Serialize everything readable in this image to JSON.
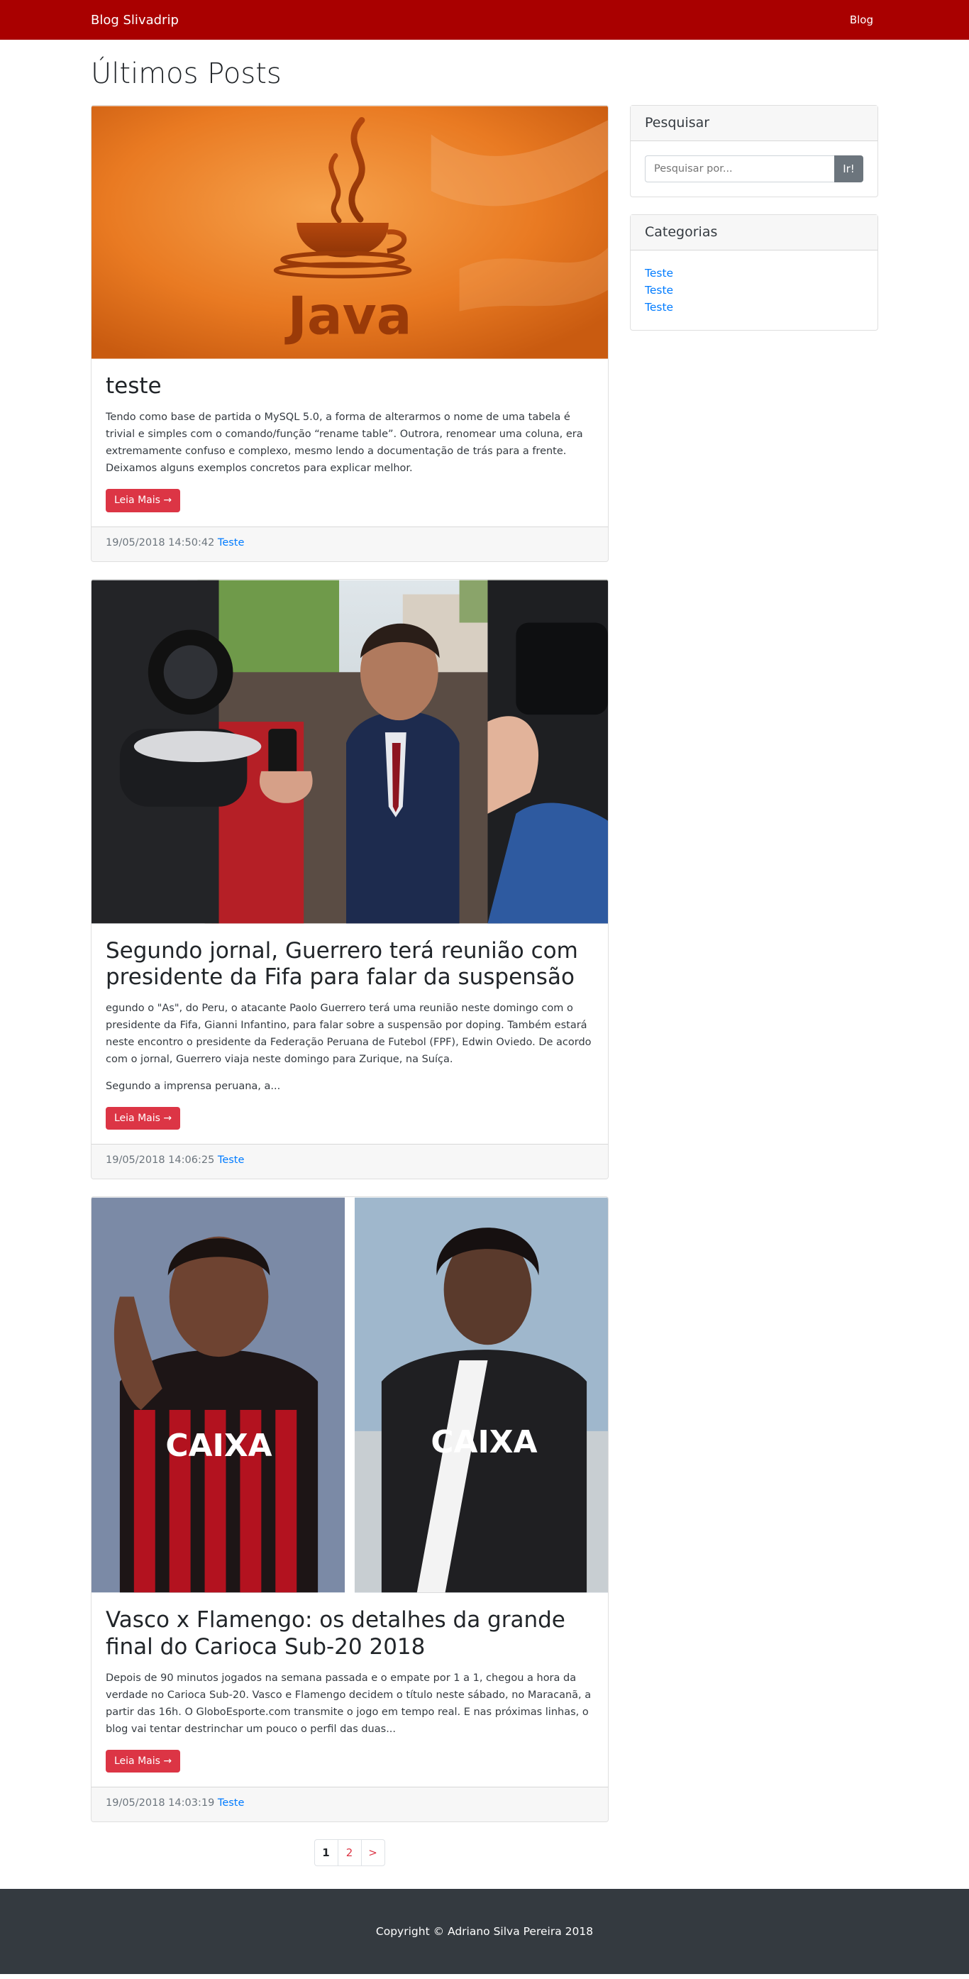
{
  "navbar": {
    "brand": "Blog Slivadrip",
    "link": "Blog"
  },
  "page_title": "Últimos Posts",
  "posts": [
    {
      "title": "teste",
      "text": "Tendo como base de partida o MySQL 5.0, a forma de alterarmos o nome de uma tabela é trivial e simples com o comando/função “rename table”. Outrora, renomear uma coluna, era extremamente confuso e complexo, mesmo lendo a documentação de trás para a frente. Deixamos alguns exemplos concretos para explicar melhor.",
      "button": "Leia Mais →",
      "date": "19/05/2018 14:50:42",
      "category": "Teste",
      "image": "java-logo"
    },
    {
      "title": "Segundo jornal, Guerrero terá reunião com presidente da Fifa para falar da suspensão",
      "text": "egundo o \"As\", do Peru, o atacante Paolo Guerrero terá uma reunião neste domingo com o presidente da Fifa, Gianni Infantino, para falar sobre a suspensão por doping. Também estará neste encontro o presidente da Federação Peruana de Futebol (FPF), Edwin Oviedo. De acordo com o jornal, Guerrero viaja neste domingo para Zurique, na Suíça.",
      "text2": "Segundo a imprensa peruana, a...",
      "button": "Leia Mais →",
      "date": "19/05/2018 14:06:25",
      "category": "Teste",
      "image": "press-photo"
    },
    {
      "title": "Vasco x Flamengo: os detalhes da grande final do Carioca Sub-20 2018",
      "text": "Depois de 90 minutos jogados na semana passada e o empate por 1 a 1, chegou a hora da verdade no Carioca Sub-20. Vasco e Flamengo decidem o título neste sábado, no Maracanã, a partir das 16h. O GloboEsporte.com transmite o jogo em tempo real. E nas próximas linhas, o blog vai tentar destrinchar um pouco o perfil das duas...",
      "button": "Leia Mais →",
      "date": "19/05/2018 14:03:19",
      "category": "Teste",
      "image": "football-players"
    }
  ],
  "sidebar": {
    "search": {
      "title": "Pesquisar",
      "placeholder": "Pesquisar por...",
      "button": "Ir!"
    },
    "categories": {
      "title": "Categorias",
      "items": [
        "Teste",
        "Teste",
        "Teste"
      ]
    }
  },
  "pagination": {
    "pages": [
      "1",
      "2",
      ">"
    ],
    "active": "1"
  },
  "footer": {
    "copyright": "Copyright © Adriano Silva Pereira 2018"
  },
  "colors": {
    "navbar": "#a90000",
    "button": "#dc3545",
    "link": "#007bff",
    "footer": "#343a40"
  }
}
